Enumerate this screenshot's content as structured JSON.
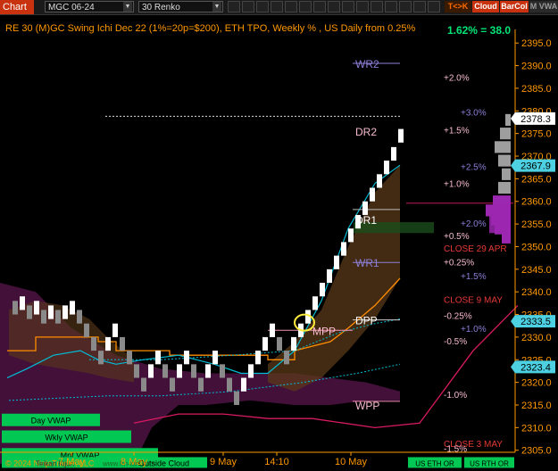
{
  "toolbar": {
    "title": "Chart",
    "instrument": "MGC 06-24",
    "period": "30 Renko",
    "buttons": [
      {
        "label": "T<>K",
        "color": "#ff6a00",
        "bg": "#3a1a00"
      },
      {
        "label": "Cloud",
        "color": "#ffffff",
        "bg": "#c8320f"
      },
      {
        "label": "BarCol",
        "color": "#ffffff",
        "bg": "#c8320f"
      },
      {
        "label": "M VWA",
        "color": "#9a9a9a",
        "bg": "#2a2a2a"
      }
    ]
  },
  "chart_header": {
    "description": "RE 30 (M)GC Swing Ichi Dec 22 (1%=20p=$200), ETH TPO, Weekly % , US Daily from 0.25%",
    "summary": "1.62% = 38.0",
    "summary_color": "#00e676",
    "header_color": "#ff9800"
  },
  "chart_data": {
    "type": "candlestick",
    "ylim": [
      2301,
      2398
    ],
    "y_ticks": [
      2305.0,
      2310.0,
      2315.0,
      2320.0,
      2325.0,
      2330.0,
      2335.0,
      2340.0,
      2345.0,
      2350.0,
      2355.0,
      2360.0,
      2365.0,
      2370.0,
      2375.0,
      2380.0,
      2385.0,
      2390.0,
      2395.0
    ],
    "x_labels": [
      "7 May",
      "8 May",
      "9 May",
      "14:10",
      "10 May"
    ],
    "price_badges": [
      {
        "value": "2378.3",
        "price": 2378.3,
        "bg": "#ffffff",
        "fg": "#000000"
      },
      {
        "value": "2367.9",
        "price": 2367.9,
        "bg": "#4dd0e1",
        "fg": "#000000"
      },
      {
        "value": "2333.5",
        "price": 2333.5,
        "bg": "#4dd0e1",
        "fg": "#000000"
      },
      {
        "value": "2323.4",
        "price": 2323.4,
        "bg": "#4dd0e1",
        "fg": "#000000"
      }
    ],
    "pivot_labels": [
      {
        "text": "WR2",
        "price": 2390.5,
        "color": "#8c7fd8"
      },
      {
        "text": "DR2",
        "price": 2375.5,
        "color": "#f8bbd0"
      },
      {
        "text": "DR1",
        "price": 2356.0,
        "color": "#ffffff"
      },
      {
        "text": "WR1",
        "price": 2346.5,
        "color": "#8c7fd8"
      },
      {
        "text": "DPP",
        "price": 2333.8,
        "color": "#ffffff"
      },
      {
        "text": "MPP",
        "price": 2331.5,
        "color": "#f8bbd0"
      },
      {
        "text": "WPP",
        "price": 2315.0,
        "color": "#f8bbd0"
      }
    ],
    "percent_labels": [
      {
        "text": "+2.0%",
        "price": 2387.5,
        "color": "#f8bbd0"
      },
      {
        "text": "+3.0%",
        "price": 2379.8,
        "color": "#8c7fd8"
      },
      {
        "text": "+1.5%",
        "price": 2375.8,
        "color": "#f8bbd0"
      },
      {
        "text": "+2.5%",
        "price": 2367.7,
        "color": "#8c7fd8"
      },
      {
        "text": "+1.0%",
        "price": 2364.0,
        "color": "#f8bbd0"
      },
      {
        "text": "+2.0%",
        "price": 2355.2,
        "color": "#8c7fd8"
      },
      {
        "text": "+0.5%",
        "price": 2352.5,
        "color": "#f8bbd0"
      },
      {
        "text": "CLOSE 29 APR",
        "price": 2349.7,
        "color": "#e53935"
      },
      {
        "text": "+0.25%",
        "price": 2346.6,
        "color": "#f8bbd0"
      },
      {
        "text": "+1.5%",
        "price": 2343.6,
        "color": "#8c7fd8"
      },
      {
        "text": "CLOSE 9 MAY",
        "price": 2338.4,
        "color": "#e53935"
      },
      {
        "text": "-0.25%",
        "price": 2334.8,
        "color": "#f8bbd0"
      },
      {
        "text": "+1.0%",
        "price": 2332.0,
        "color": "#8c7fd8"
      },
      {
        "text": "-0.5%",
        "price": 2329.2,
        "color": "#f8bbd0"
      },
      {
        "text": "-1.0%",
        "price": 2317.4,
        "color": "#f8bbd0"
      },
      {
        "text": "CLOSE 3 MAY",
        "price": 2306.5,
        "color": "#e53935"
      },
      {
        "text": "-1.5%",
        "price": 2305.4,
        "color": "#f8bbd0"
      }
    ],
    "vwap_labels": [
      {
        "text": "Day VWAP",
        "price": 2311.5
      },
      {
        "text": "Wkly VWAP",
        "price": 2307.8
      },
      {
        "text": "Mnt VWAP",
        "price": 2303.9
      }
    ],
    "footer_labels": {
      "copyright": "© 2024 NinjaTrader, LLC",
      "teikan": "Teikan Kijun",
      "url": "www.hn-ain.com",
      "outside_cloud": "Outside Cloud",
      "us_eth": "US ETH OR",
      "us_rth": "US RTH OR"
    },
    "colors": {
      "up_brick": "#ffffff",
      "down_brick": "#8a8a8a",
      "kijun": "#ff8c00",
      "tenkan": "#00bcd4",
      "cloud": "#4a1240",
      "cloud_bull": "#5a3a1a",
      "weekly_vwap": "#d81b60",
      "vwap_green": "#00c853",
      "axis": "#ff9800",
      "profile": "#9c27b0"
    }
  }
}
